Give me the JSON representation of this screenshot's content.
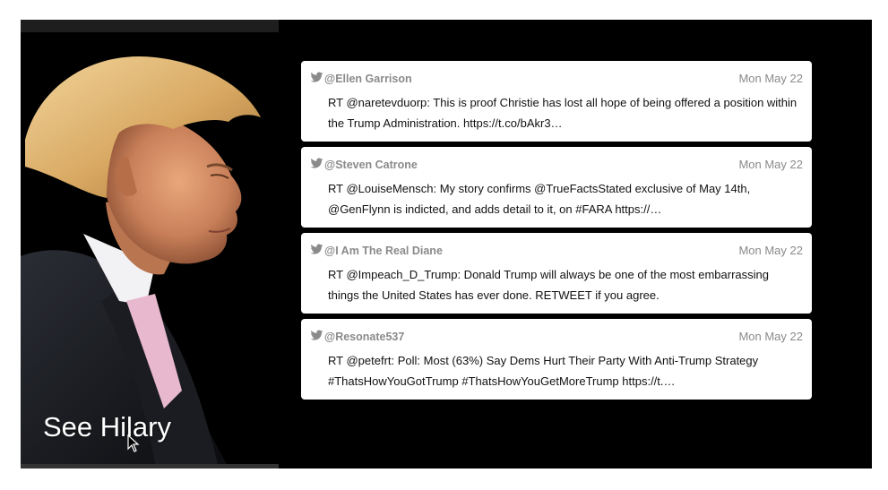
{
  "hero": {
    "link_label": "See Hilary"
  },
  "tweets": [
    {
      "handle": "@Ellen Garrison",
      "date": "Mon May 22",
      "line1": "RT @naretevduorp: This is proof Christie has lost all hope of being offered a position within",
      "line2": "the Trump Administration. https://t.co/bAkr3…"
    },
    {
      "handle": "@Steven Catrone",
      "date": "Mon May 22",
      "line1": "RT @LouiseMensch: My story confirms @TrueFactsStated exclusive of May 14th,",
      "line2": "@GenFlynn is indicted, and adds detail to it, on #FARA https://…"
    },
    {
      "handle": "@I Am The Real Diane",
      "date": "Mon May 22",
      "line1": "RT @Impeach_D_Trump: Donald Trump will always be one of the most embarrassing",
      "line2": "things the United States has ever done. RETWEET if you agree."
    },
    {
      "handle": "@Resonate537",
      "date": "Mon May 22",
      "line1": "RT @petefrt: Poll: Most (63%) Say Dems Hurt Their Party With Anti-Trump Strategy",
      "line2": "#ThatsHowYouGotTrump #ThatsHowYouGetMoreTrump https://t.…"
    }
  ],
  "icons": {
    "tweet_source": "twitter-bird-icon",
    "pointer": "mouse-cursor-icon"
  },
  "colors": {
    "background": "#000000",
    "card": "#ffffff",
    "meta_text": "#8a8a8a",
    "body_text": "#111111"
  }
}
